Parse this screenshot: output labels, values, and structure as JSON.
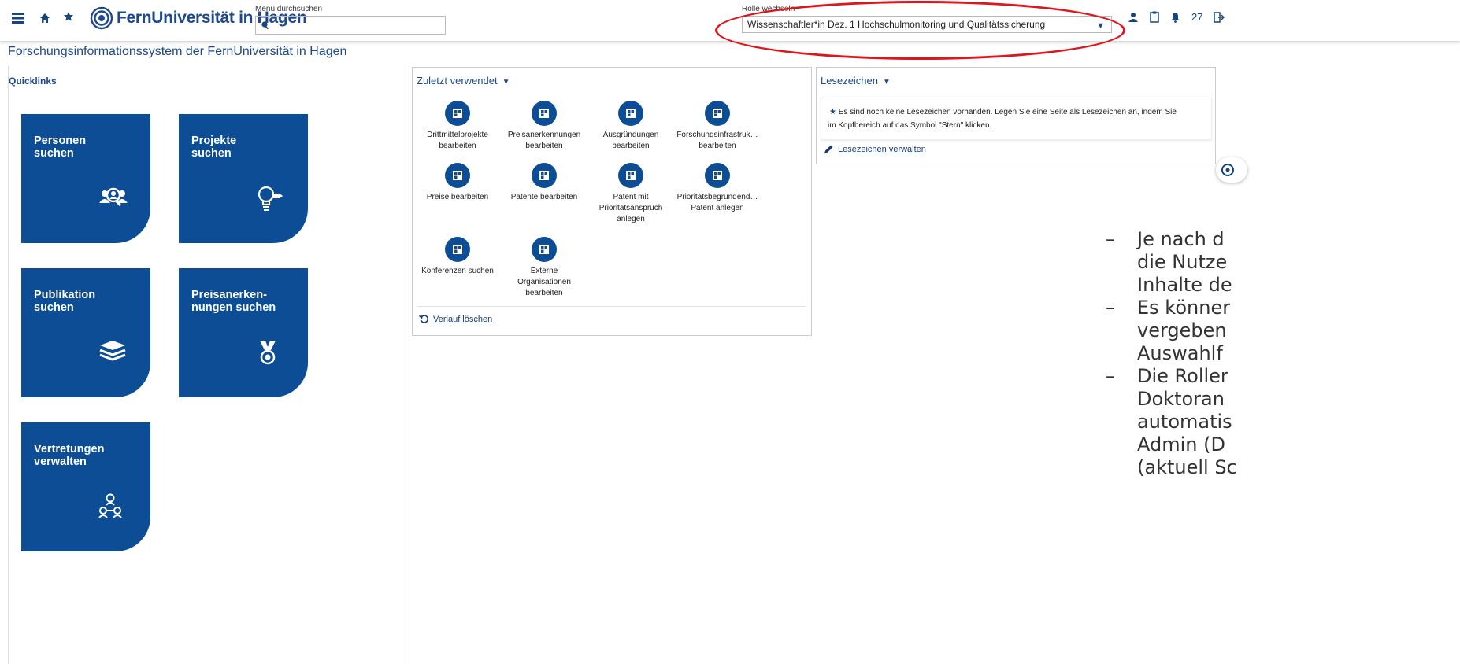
{
  "header": {
    "logo_text": "FernUniversität in Hagen",
    "menu_search_label": "Menü durchsuchen",
    "role_label": "Rolle wechseln",
    "role_value": "Wissenschaftler*in Dez. 1 Hochschulmonitoring und Qualitätssicherung",
    "notification_count": "27"
  },
  "page_title": "Forschungsinformationssystem der FernUniversität in Hagen",
  "quicklinks": {
    "title": "Quicklinks",
    "tiles": [
      {
        "label": "Personen\nsuchen"
      },
      {
        "label": "Projekte\nsuchen"
      },
      {
        "label": "Publikation\nsuchen"
      },
      {
        "label": "Preisanerken-\nnungen suchen"
      },
      {
        "label": "Vertretungen\nverwalten"
      }
    ]
  },
  "recent": {
    "title": "Zuletzt verwendet",
    "items": [
      {
        "label": "Drittmittelprojekte\nbearbeiten"
      },
      {
        "label": "Preisanerkennungen\nbearbeiten"
      },
      {
        "label": "Ausgründungen\nbearbeiten"
      },
      {
        "label": "Forschungsinfrastruk…\nbearbeiten"
      },
      {
        "label": "Preise bearbeiten"
      },
      {
        "label": "Patente bearbeiten"
      },
      {
        "label": "Patent mit\nPrioritätsanspruch\nanlegen"
      },
      {
        "label": "Prioritätsbegründend…\nPatent anlegen"
      },
      {
        "label": "Konferenzen suchen"
      },
      {
        "label": "Externe\nOrganisationen\nbearbeiten"
      }
    ],
    "clear_label": "Verlauf löschen"
  },
  "bookmarks": {
    "title": "Lesezeichen",
    "info_line1": "Es sind noch keine Lesezeichen vorhanden. Legen Sie eine Seite als Lesezeichen an, indem Sie",
    "info_line2": "im Kopfbereich auf das Symbol \"Stern\" klicken.",
    "manage_label": "Lesezeichen verwalten"
  },
  "slide_notes": {
    "bullet1_lines": [
      "Je nach d",
      "die Nutze",
      "Inhalte de"
    ],
    "bullet2_lines": [
      "Es könner",
      "vergeben",
      "Auswahlf"
    ],
    "bullet3_lines": [
      "Die Roller",
      "Doktoran",
      "automatis",
      "Admin (D",
      "(aktuell Sc"
    ]
  },
  "colors": {
    "accent": "#0c4d95",
    "highlight": "#e0151b"
  }
}
